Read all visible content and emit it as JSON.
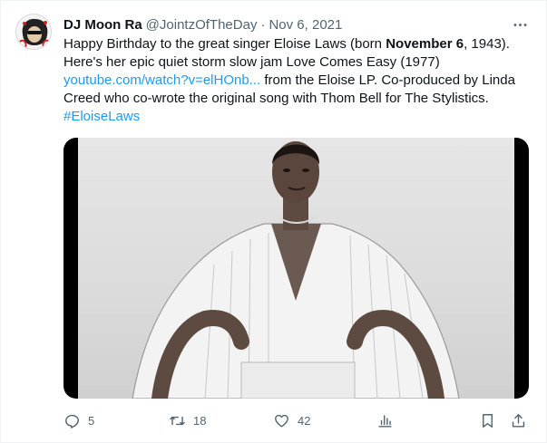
{
  "author": {
    "display_name": "DJ Moon Ra",
    "handle": "@JointzOfTheDay",
    "separator": "·",
    "date": "Nov 6, 2021"
  },
  "tweet": {
    "line1_a": "Happy Birthday to the great singer Eloise Laws (born ",
    "line1_bold": "November 6",
    "line1_b": ", 1943).",
    "line2": "Here's her epic quiet storm slow jam Love Comes Easy (1977)",
    "line3_link": "youtube.com/watch?v=elHOnb...",
    "line3_rest": " from the Eloise LP. Co-produced by Linda",
    "line4": "Creed who co-wrote the original song with Thom Bell for The Stylistics.",
    "hashtag": "#EloiseLaws"
  },
  "actions": {
    "replies": "5",
    "retweets": "18",
    "likes": "42"
  },
  "icons": {
    "more": "more-horizontal-icon",
    "reply": "reply-icon",
    "retweet": "retweet-icon",
    "like": "heart-icon",
    "views": "analytics-icon",
    "bookmark": "bookmark-icon",
    "share": "share-icon"
  },
  "colors": {
    "text": "#0f1419",
    "muted": "#536471",
    "link": "#1d9bf0"
  }
}
